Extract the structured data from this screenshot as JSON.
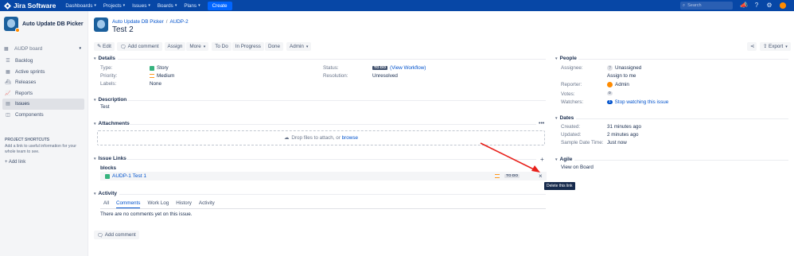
{
  "topnav": {
    "logo": "Jira Software",
    "items": [
      {
        "label": "Dashboards"
      },
      {
        "label": "Projects"
      },
      {
        "label": "Issues"
      },
      {
        "label": "Boards"
      },
      {
        "label": "Plans"
      }
    ],
    "create_label": "Create",
    "search_placeholder": "Search"
  },
  "sidebar": {
    "project_name": "Auto Update DB Picker",
    "board_label": "AUDP board",
    "items": [
      {
        "label": "Backlog"
      },
      {
        "label": "Active sprints"
      },
      {
        "label": "Releases"
      },
      {
        "label": "Reports"
      },
      {
        "label": "Issues"
      },
      {
        "label": "Components"
      }
    ],
    "shortcuts_title": "PROJECT SHORTCUTS",
    "shortcuts_desc": "Add a link to useful information for your whole team to see.",
    "add_link": "Add link"
  },
  "issue": {
    "breadcrumb_project": "Auto Update DB Picker",
    "breadcrumb_key": "AUDP-2",
    "title": "Test 2"
  },
  "toolbar": {
    "edit": "Edit",
    "add_comment": "Add comment",
    "assign": "Assign",
    "more": "More",
    "todo": "To Do",
    "in_progress": "In Progress",
    "done": "Done",
    "admin": "Admin",
    "export": "Export"
  },
  "details": {
    "header": "Details",
    "type_label": "Type:",
    "type_value": "Story",
    "priority_label": "Priority:",
    "priority_value": "Medium",
    "labels_label": "Labels:",
    "labels_value": "None",
    "status_label": "Status:",
    "status_lozenge": "TO DO",
    "status_workflow": "(View Workflow)",
    "resolution_label": "Resolution:",
    "resolution_value": "Unresolved"
  },
  "description": {
    "header": "Description",
    "text": "Test"
  },
  "attachments": {
    "header": "Attachments",
    "drop_text": "Drop files to attach, or",
    "browse": "browse",
    "more": "•••"
  },
  "issue_links": {
    "header": "Issue Links",
    "relation": "blocks",
    "link_key": "AUDP-1",
    "link_summary": "Test 1",
    "link_status": "TO DO",
    "delete_tooltip": "Delete this link",
    "add": "+",
    "delete": "×"
  },
  "activity": {
    "header": "Activity",
    "tabs": [
      {
        "label": "All"
      },
      {
        "label": "Comments"
      },
      {
        "label": "Work Log"
      },
      {
        "label": "History"
      },
      {
        "label": "Activity"
      }
    ],
    "empty": "There are no comments yet on this issue.",
    "add_comment": "Add comment"
  },
  "people": {
    "header": "People",
    "assignee_label": "Assignee:",
    "assignee_value": "Unassigned",
    "assign_to_me": "Assign to me",
    "reporter_label": "Reporter:",
    "reporter_value": "Admin",
    "votes_label": "Votes:",
    "votes_count": "0",
    "watchers_label": "Watchers:",
    "watchers_count": "1",
    "watchers_action": "Stop watching this issue"
  },
  "dates": {
    "header": "Dates",
    "created_label": "Created:",
    "created_value": "31 minutes ago",
    "updated_label": "Updated:",
    "updated_value": "2 minutes ago",
    "sample_label": "Sample Date Time:",
    "sample_value": "Just now"
  },
  "agile": {
    "header": "Agile",
    "view_on_board": "View on Board"
  },
  "colors": {
    "nav": "#0747a6",
    "link": "#0052cc",
    "annotation_arrow": "#e8201a"
  }
}
